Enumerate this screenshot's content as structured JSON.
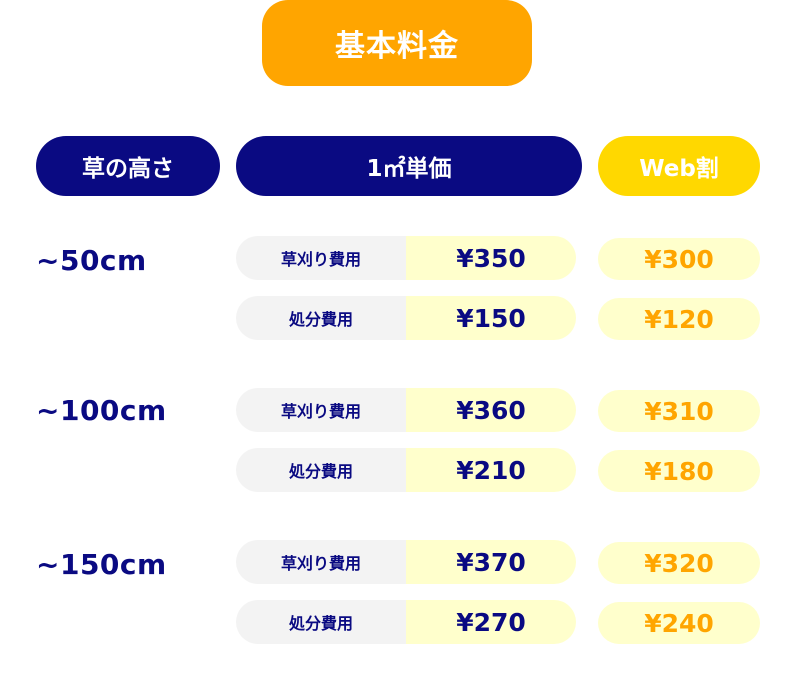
{
  "title": "基本料金",
  "headers": {
    "height": "草の高さ",
    "unit_price_main": "1㎡単価",
    "web_discount": "Web割"
  },
  "groups": [
    {
      "label": "~50cm",
      "rows": [
        {
          "label": "草刈り費用",
          "price": "¥350",
          "web": "¥300"
        },
        {
          "label": "処分費用",
          "price": "¥150",
          "web": "¥120"
        }
      ]
    },
    {
      "label": "~100cm",
      "rows": [
        {
          "label": "草刈り費用",
          "price": "¥360",
          "web": "¥310"
        },
        {
          "label": "処分費用",
          "price": "¥210",
          "web": "¥180"
        }
      ]
    },
    {
      "label": "~150cm",
      "rows": [
        {
          "label": "草刈り費用",
          "price": "¥370",
          "web": "¥320"
        },
        {
          "label": "処分費用",
          "price": "¥270",
          "web": "¥240"
        }
      ]
    }
  ],
  "colors": {
    "navy": "#0A0A82",
    "orange": "#FFA500",
    "yellow": "#FFD800",
    "cream": "#FFFFCC",
    "gray": "#F3F3F3"
  }
}
